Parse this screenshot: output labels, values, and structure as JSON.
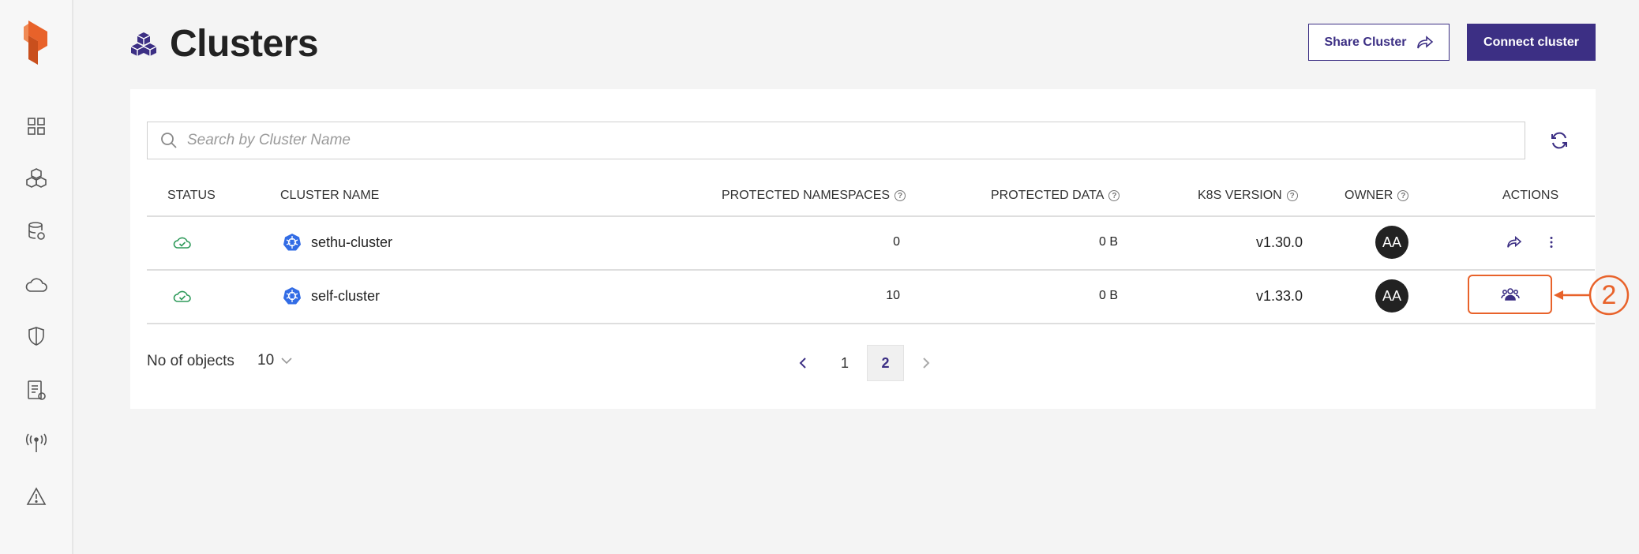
{
  "header": {
    "title": "Clusters",
    "share_label": "Share Cluster",
    "connect_label": "Connect cluster"
  },
  "search": {
    "placeholder": "Search by Cluster Name",
    "value": ""
  },
  "table": {
    "columns": [
      "STATUS",
      "CLUSTER NAME",
      "PROTECTED NAMESPACES",
      "PROTECTED DATA",
      "K8S VERSION",
      "OWNER",
      "ACTIONS"
    ],
    "rows": [
      {
        "status": "cloud-check",
        "name": "sethu-cluster",
        "namespaces": "0",
        "data": "0 B",
        "version": "v1.30.0",
        "owner": "AA"
      },
      {
        "status": "cloud-check",
        "name": "self-cluster",
        "namespaces": "10",
        "data": "0 B",
        "version": "v1.33.0",
        "owner": "AA"
      }
    ]
  },
  "footer": {
    "objects_label": "No of objects",
    "per_page": "10",
    "pages": [
      "1",
      "2"
    ],
    "current_page": "2"
  },
  "annotation": {
    "step": "2"
  },
  "colors": {
    "primary": "#3c2f84",
    "accent": "#e8622a",
    "status_ok": "#2e9a5a",
    "k8s_blue": "#326ce5"
  },
  "icons": {
    "sidebar": [
      "grid-icon",
      "cubes-icon",
      "database-icon",
      "cloud-icon",
      "shield-icon",
      "report-icon",
      "antenna-icon",
      "warning-icon"
    ]
  }
}
